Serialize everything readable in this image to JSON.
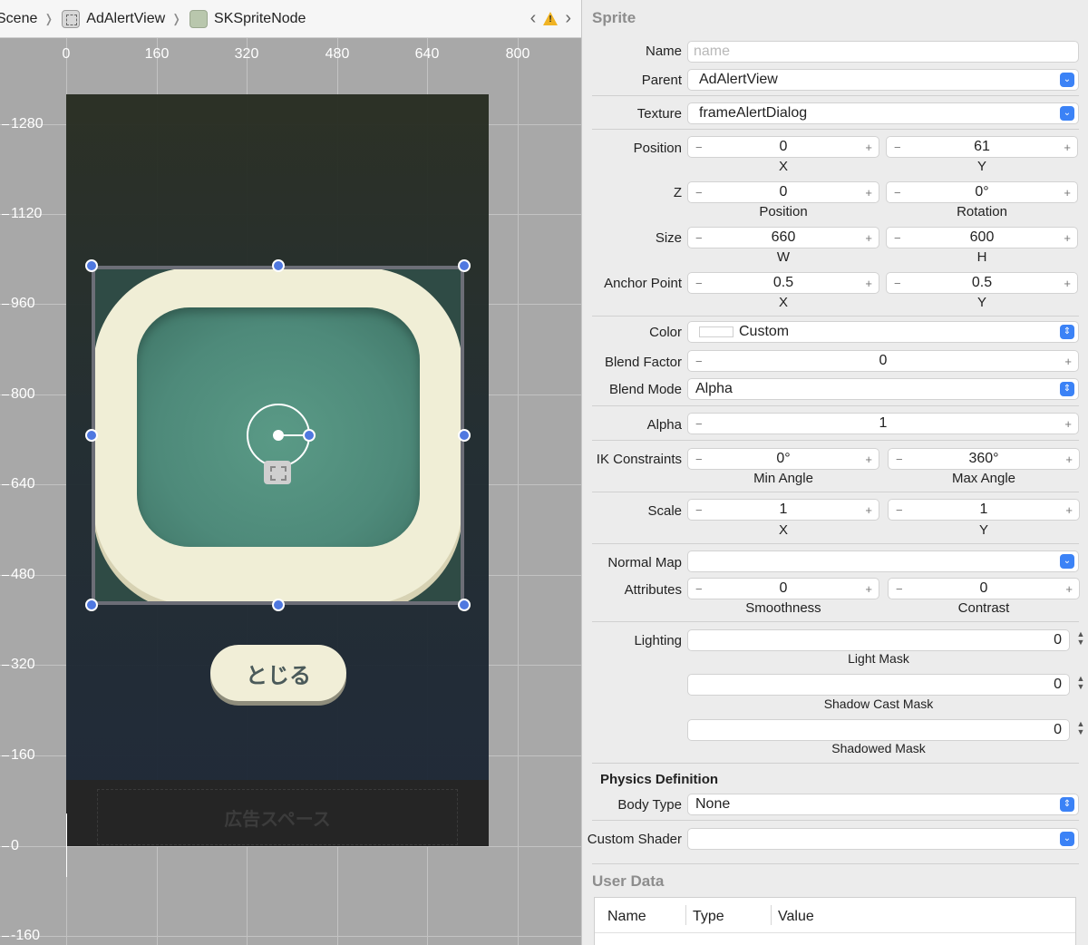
{
  "breadcrumb": {
    "items": [
      "Scene",
      "AdAlertView",
      "SKSpriteNode"
    ]
  },
  "ruler": {
    "x_labels": [
      "0",
      "160",
      "320",
      "480",
      "640",
      "800"
    ],
    "y_labels": [
      "1280",
      "1120",
      "960",
      "800",
      "640",
      "480",
      "320",
      "160",
      "0",
      "-160"
    ]
  },
  "scene": {
    "close_button_label": "とじる",
    "ad_space_label": "広告スペース"
  },
  "inspector": {
    "section_title": "Sprite",
    "name": {
      "label": "Name",
      "placeholder": "name"
    },
    "parent": {
      "label": "Parent",
      "value": "AdAlertView"
    },
    "texture": {
      "label": "Texture",
      "value": "frameAlertDialog"
    },
    "position": {
      "label": "Position",
      "x": "0",
      "y": "61",
      "x_label": "X",
      "y_label": "Y"
    },
    "z": {
      "label": "Z",
      "position": "0",
      "rotation": "0°",
      "position_label": "Position",
      "rotation_label": "Rotation"
    },
    "size": {
      "label": "Size",
      "w": "660",
      "h": "600",
      "w_label": "W",
      "h_label": "H"
    },
    "anchor": {
      "label": "Anchor Point",
      "x": "0.5",
      "y": "0.5",
      "x_label": "X",
      "y_label": "Y"
    },
    "color": {
      "label": "Color",
      "value": "Custom"
    },
    "blend_factor": {
      "label": "Blend Factor",
      "value": "0"
    },
    "blend_mode": {
      "label": "Blend Mode",
      "value": "Alpha"
    },
    "alpha": {
      "label": "Alpha",
      "value": "1"
    },
    "ik": {
      "label": "IK Constraints",
      "min": "0°",
      "max": "360°",
      "min_label": "Min Angle",
      "max_label": "Max Angle"
    },
    "scale": {
      "label": "Scale",
      "x": "1",
      "y": "1",
      "x_label": "X",
      "y_label": "Y"
    },
    "normal_map": {
      "label": "Normal Map",
      "value": ""
    },
    "attributes": {
      "label": "Attributes",
      "smoothness": "0",
      "contrast": "0",
      "smoothness_label": "Smoothness",
      "contrast_label": "Contrast"
    },
    "lighting": {
      "label": "Lighting",
      "light_mask": "0",
      "light_mask_label": "Light Mask",
      "shadow_cast_mask": "0",
      "shadow_cast_mask_label": "Shadow Cast Mask",
      "shadowed_mask": "0",
      "shadowed_mask_label": "Shadowed Mask"
    },
    "physics_title": "Physics Definition",
    "body_type": {
      "label": "Body Type",
      "value": "None"
    },
    "custom_shader": {
      "label": "Custom Shader",
      "value": ""
    },
    "user_data": {
      "title": "User Data",
      "columns": [
        "Name",
        "Type",
        "Value"
      ]
    }
  },
  "colors": {
    "accent": "#3b82f6",
    "handle": "#4f78e0",
    "frame_cream": "#f0eed6",
    "frame_teal": "#4e8a7a",
    "warning": "#f0b323"
  }
}
